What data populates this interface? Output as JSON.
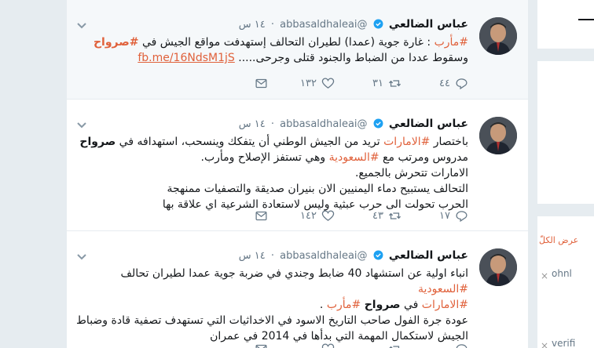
{
  "tweets": [
    {
      "name": "عباس الضالعي",
      "handle": "@abbasaldhaleai",
      "time": "١٤ س",
      "body": [
        [
          {
            "t": "#مأرب",
            "h": true
          },
          {
            "t": " : غارة جوية (عمدا) لطيران التحالف إستهدفت مواقع الجيش في "
          },
          {
            "t": "#صرواح",
            "h": true,
            "b": true
          }
        ],
        [
          {
            "t": "وسقوط عددا من الضباط والجنود قتلى وجرحى..... "
          },
          {
            "t": "fb.me/16NdsM1jS",
            "link": true
          }
        ]
      ],
      "replies": "٤٤",
      "retweets": "٣١",
      "likes": "١٣٢"
    },
    {
      "name": "عباس الضالعي",
      "handle": "@abbasaldhaleai",
      "time": "١٤ س",
      "body": [
        [
          {
            "t": "باختصار "
          },
          {
            "t": "#الامارات",
            "h": true
          },
          {
            "t": " تريد من الجيش الوطني أن يتفكك وينسحب، استهدافه في "
          },
          {
            "t": "صرواح",
            "b": true
          }
        ],
        [
          {
            "t": "مدروس ومرتب مع "
          },
          {
            "t": "#السعودية",
            "h": true
          },
          {
            "t": " وهي تستفز الإصلاح ومأرب."
          }
        ],
        [
          {
            "t": "الامارات تتحرش بالجميع."
          }
        ],
        [
          {
            "t": "التحالف يستبيح دماء اليمنيين الان بنيران صديقة والتصفيات ممنهجة"
          }
        ],
        [
          {
            "t": "الحرب تحولت الى حرب عبثية وليس لاستعادة الشرعية اي علاقة بها"
          }
        ]
      ],
      "replies": "١٧",
      "retweets": "٤٣",
      "likes": "١٤٢"
    },
    {
      "name": "عباس الضالعي",
      "handle": "@abbasaldhaleai",
      "time": "١٤ س",
      "body": [
        [
          {
            "t": "انباء اولية عن استشهاد 40 ضابط وجندي في ضربة جوية عمدا لطيران تحالف "
          },
          {
            "t": "#السعودية",
            "h": true
          }
        ],
        [
          {
            "t": "#الامارات",
            "h": true
          },
          {
            "t": " في "
          },
          {
            "t": "صرواح",
            "b": true
          },
          {
            "t": " "
          },
          {
            "t": "#مأرب",
            "h": true
          },
          {
            "t": " ."
          }
        ],
        [
          {
            "t": " "
          }
        ],
        [
          {
            "t": "عودة جرة الفول صاحب التاريخ الاسود في الاخداثيات التي تستهدف تصفية قادة وضباط"
          }
        ],
        [
          {
            "t": "الجيش لاستكمال المهمة التي بدأها في 2014 في عمران"
          }
        ]
      ],
      "replies": "",
      "retweets": "",
      "likes": ""
    }
  ],
  "sidebar": {
    "view_all": "عرض الكلّ",
    "suggestion_1": "ohnl",
    "suggestion_2": "verifi"
  },
  "colors": {
    "accent": "#e0613b",
    "muted": "#657786",
    "verified": "#1da1f2"
  },
  "icons": [
    "chevron-down-icon",
    "verified-badge-icon",
    "reply-icon",
    "retweet-icon",
    "like-icon",
    "direct-message-icon"
  ]
}
